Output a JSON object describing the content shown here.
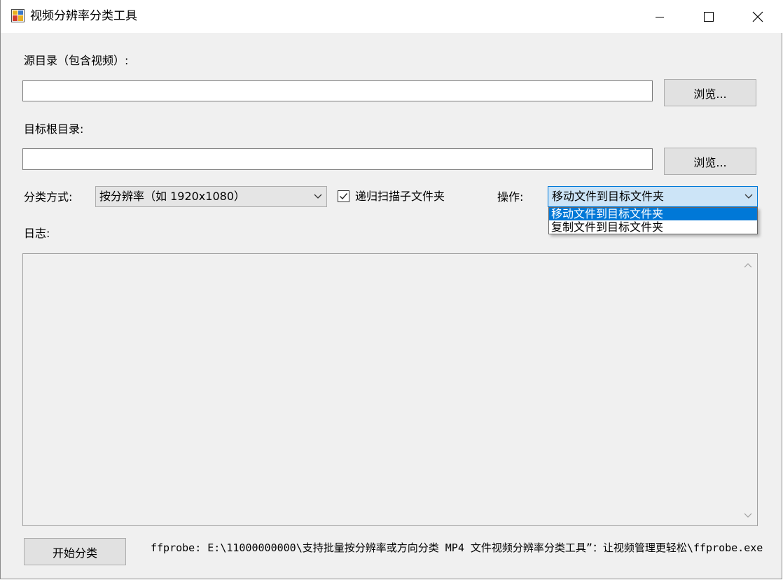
{
  "window": {
    "title": "视频分辨率分类工具",
    "icon": "app-icon"
  },
  "source": {
    "label": "源目录（包含视频）:",
    "value": "",
    "browse_label": "浏览..."
  },
  "target": {
    "label": "目标根目录:",
    "value": "",
    "browse_label": "浏览..."
  },
  "classify": {
    "label": "分类方式:",
    "selected": "按分辨率（如 1920x1080）"
  },
  "recursive": {
    "label": "递归扫描子文件夹",
    "checked": true
  },
  "operation": {
    "label": "操作:",
    "selected": "移动文件到目标文件夹",
    "options": [
      "移动文件到目标文件夹",
      "复制文件到目标文件夹"
    ]
  },
  "log": {
    "label": "日志:",
    "content": ""
  },
  "start_button_label": "开始分类",
  "status_text": "ffprobe: E:\\11000000000\\支持批量按分辨率或方向分类 MP4 文件视频分辨率分类工具”：让视频管理更轻松\\ffprobe.exe",
  "colors": {
    "accent": "#0078d7",
    "window_bg": "#f0f0f0",
    "button_bg": "#e1e1e1"
  }
}
